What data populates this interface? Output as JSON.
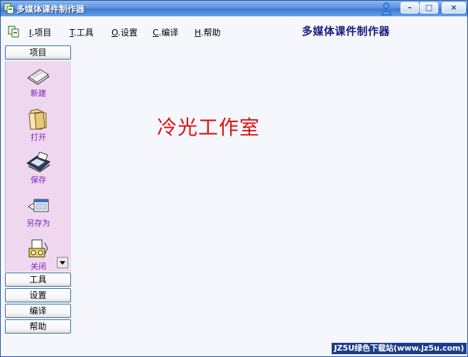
{
  "window": {
    "title": "多媒体课件制作器"
  },
  "controls": {
    "minimize": "–",
    "maximize": "□",
    "close": "×"
  },
  "menu": [
    {
      "accel": "I",
      "label": ".项目"
    },
    {
      "accel": "T",
      "label": ".工具"
    },
    {
      "accel": "O",
      "label": ".设置"
    },
    {
      "accel": "C",
      "label": ".编译"
    },
    {
      "accel": "H",
      "label": ".帮助"
    }
  ],
  "app_title": "多媒体课件制作器",
  "sidebar": {
    "sections": [
      "项目",
      "工具",
      "设置",
      "编译",
      "帮助"
    ],
    "tools": [
      "新建",
      "打开",
      "保存",
      "另存为",
      "关闭"
    ]
  },
  "content": {
    "studio_text": "冷光工作室"
  },
  "watermark": "JZ5U绿色下载站(www.jz5u.com)",
  "colors": {
    "title_accent": "#1a1a7a",
    "studio_text": "#e01010",
    "tool_label": "#7b1fc0",
    "panel_bg": "#efd8ef"
  }
}
